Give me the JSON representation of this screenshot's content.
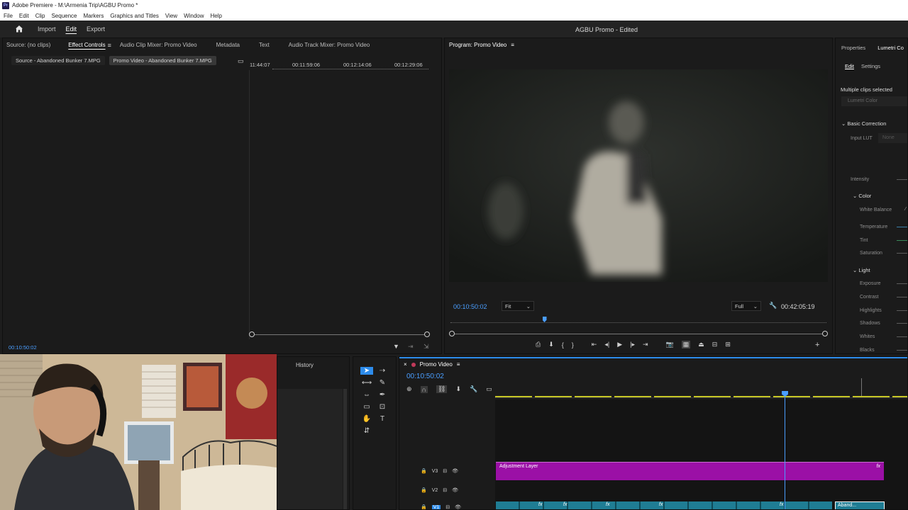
{
  "app": {
    "logo": "Pr",
    "window_title": "Adobe Premiere - M:\\Armenia Trip\\AGBU Promo *",
    "menu": [
      "File",
      "Edit",
      "Clip",
      "Sequence",
      "Markers",
      "Graphics and Titles",
      "View",
      "Window",
      "Help"
    ]
  },
  "workspace": {
    "tabs": [
      "Import",
      "Edit",
      "Export"
    ],
    "active_tab": "Edit",
    "project_title": "AGBU Promo - Edited"
  },
  "source_panel": {
    "tabs": [
      "Source: (no clips)",
      "Effect Controls",
      "Audio Clip Mixer: Promo Video",
      "Metadata",
      "Text",
      "Audio Track Mixer: Promo Video"
    ],
    "active_tab": "Effect Controls",
    "clip_source": "Source - Abandoned Bunker 7.MPG",
    "clip_sequence": "Promo Video - Abandoned Bunker 7.MPG",
    "ruler_times": [
      "11:44:07",
      "00:11:59:06",
      "00:12:14:06",
      "00:12:29:06"
    ],
    "timecode": "00:10:50:02"
  },
  "program_panel": {
    "title": "Program: Promo Video",
    "playhead_timecode": "00:10:50:02",
    "fit_select": "Fit",
    "quality_select": "Full",
    "duration": "00:42:05:19",
    "playhead_fraction": 0.25
  },
  "lumetri_panel": {
    "tabs": [
      "Properties",
      "Lumetri Co"
    ],
    "subtabs": [
      "Edit",
      "Settings"
    ],
    "selection_note": "Multiple clips selected",
    "effect_name": "Lumetri Color",
    "sections": {
      "basic": "Basic Correction",
      "input_lut_label": "Input LUT",
      "input_lut_value": "None",
      "intensity": "Intensity",
      "color": "Color",
      "white_balance": "White Balance",
      "temperature": "Temperature",
      "tint": "Tint",
      "saturation": "Saturation",
      "light": "Light",
      "exposure": "Exposure",
      "contrast": "Contrast",
      "highlights": "Highlights",
      "shadows": "Shadows",
      "whites": "Whites",
      "blacks": "Blacks"
    }
  },
  "history_panel": {
    "title": "History"
  },
  "timeline": {
    "sequence_name": "Promo Video",
    "timecode": "00:10:50:02",
    "tracks": [
      "V3",
      "V2",
      "V1"
    ],
    "adjustment_clip": "Adjustment Layer",
    "fx_label": "fx",
    "abandoned_clip": "Aband...",
    "playhead_fraction": 0.7
  },
  "colors": {
    "accent_blue": "#2d8ceb",
    "timecode_blue": "#4a9eff",
    "adjustment_purple": "#9b10a6",
    "clip_teal": "#1f7d94",
    "ruler_yellow": "#c8c826",
    "sequence_red": "#c0395a"
  }
}
